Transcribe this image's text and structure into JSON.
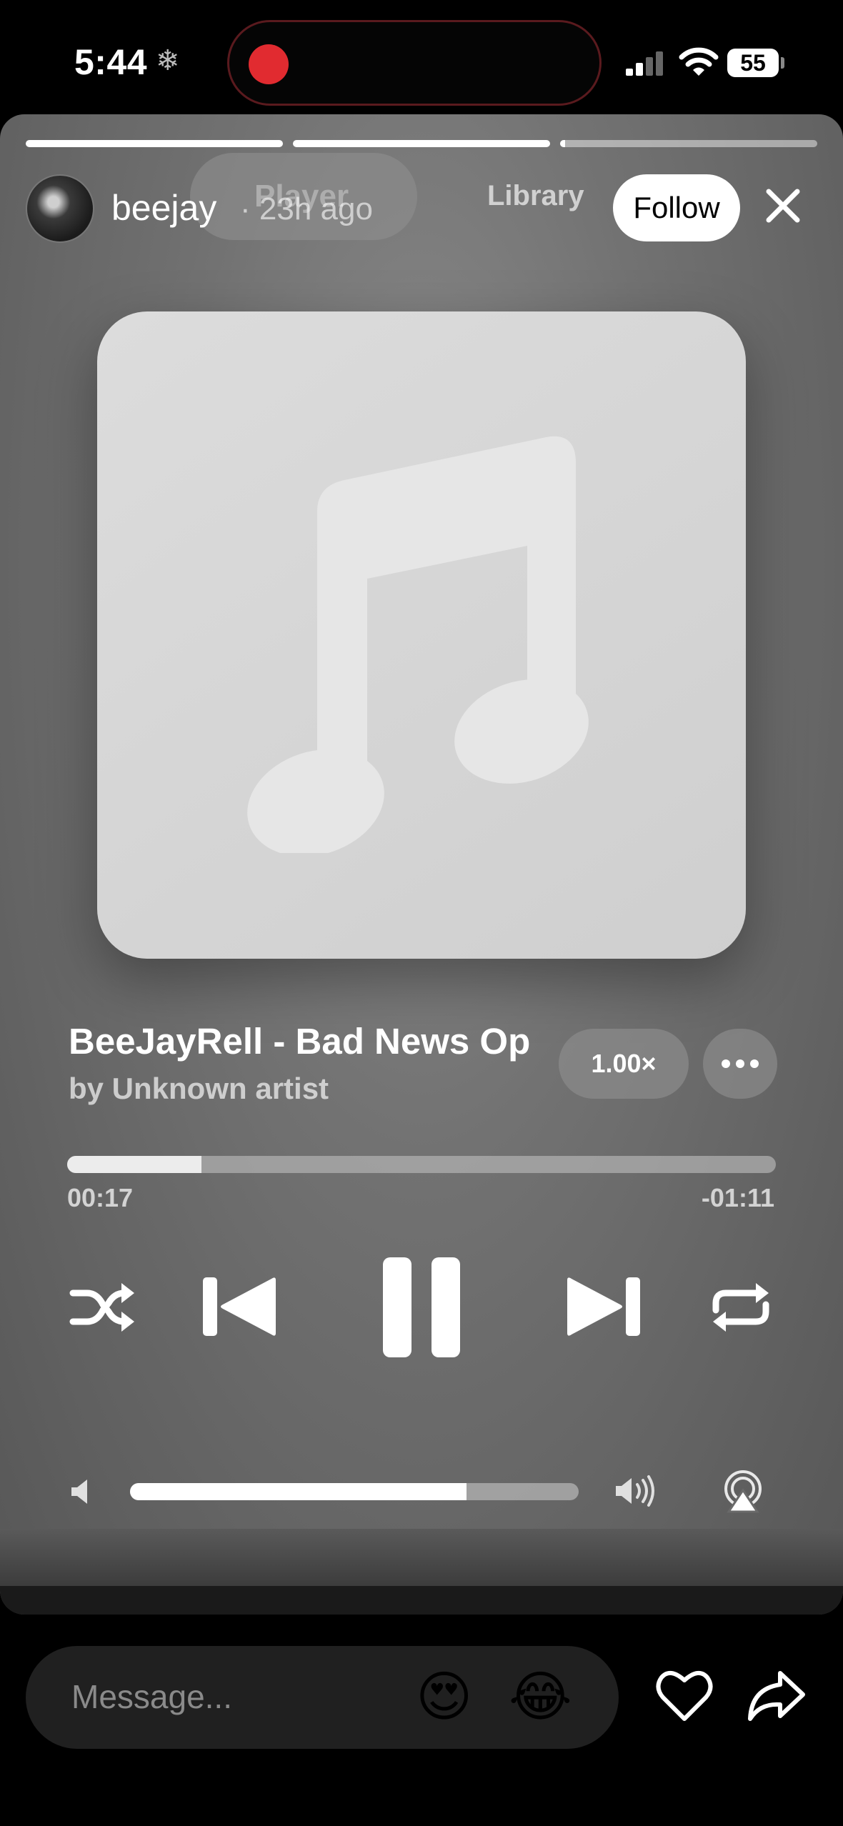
{
  "status_bar": {
    "time": "5:44",
    "battery": "55"
  },
  "story": {
    "segments": [
      {
        "progress": 1.0
      },
      {
        "progress": 1.0
      },
      {
        "progress": 0.02
      }
    ],
    "username": "beejay",
    "time_ago": "· 23h ago",
    "follow_label": "Follow"
  },
  "player": {
    "tab_player": "Player",
    "tab_library": "Library",
    "track_title": "BeeJayRell - Bad News Op",
    "track_artist": "by Unknown artist",
    "speed": "1.00×",
    "elapsed": "00:17",
    "remaining": "-01:11",
    "playback_progress": 0.19,
    "volume_level": 0.75
  },
  "composer": {
    "placeholder": "Message...",
    "quick_reactions": [
      "😍",
      "😂"
    ]
  }
}
